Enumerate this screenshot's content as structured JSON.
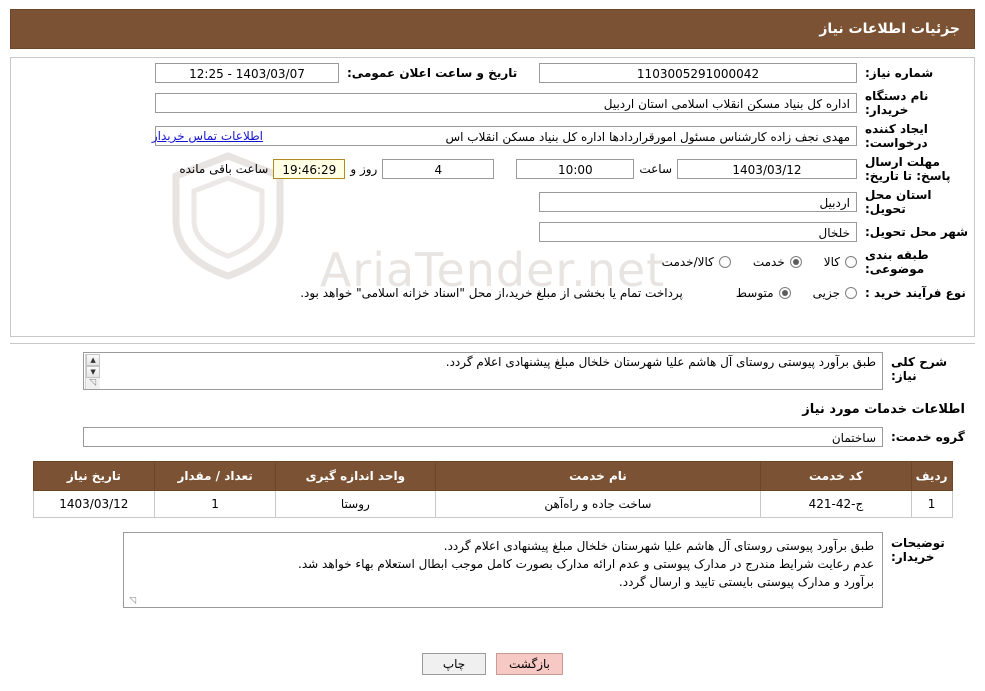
{
  "header": {
    "title": "جزئیات اطلاعات نیاز"
  },
  "form": {
    "need_number_label": "شماره نیاز:",
    "need_number_value": "1103005291000042",
    "announce_datetime_label": "تاریخ و ساعت اعلان عمومی:",
    "announce_datetime_value": "1403/03/07 - 12:25",
    "buyer_org_label": "نام دستگاه خریدار:",
    "buyer_org_value": "اداره کل بنیاد مسکن انقلاب اسلامی استان اردبیل",
    "requester_label": "ایجاد کننده درخواست:",
    "requester_value": "مهدی نجف زاده کارشناس مسئول امورقراردادها اداره کل بنیاد مسکن انقلاب اس",
    "requester_link": "اطلاعات تماس خریدار",
    "deadline_label": "مهلت ارسال پاسخ: تا تاریخ:",
    "deadline_date": "1403/03/12",
    "hour_label": "ساعت",
    "deadline_time": "10:00",
    "days_value": "4",
    "days_word": "روز و",
    "remaining_time": "19:46:29",
    "remaining_suffix": "ساعت باقی مانده",
    "delivery_province_label": "استان محل تحویل:",
    "delivery_province_value": "اردبیل",
    "delivery_city_label": "شهر محل تحویل:",
    "delivery_city_value": "خلخال",
    "category_label": "طبقه بندی موضوعی:",
    "category_options": [
      {
        "label": "کالا",
        "selected": false
      },
      {
        "label": "خدمت",
        "selected": true
      },
      {
        "label": "کالا/خدمت",
        "selected": false
      }
    ],
    "process_label": "نوع فرآیند خرید :",
    "process_options": [
      {
        "label": "جزیی",
        "selected": false
      },
      {
        "label": "متوسط",
        "selected": true
      }
    ],
    "process_note": "پرداخت تمام یا بخشی از مبلغ خرید،از محل \"اسناد خزانه اسلامی\" خواهد بود."
  },
  "description": {
    "label": "شرح کلی نیاز:",
    "value": "طبق برآورد پیوستی روستای آل هاشم علیا شهرستان خلخال مبلغ پیشنهادی اعلام گردد."
  },
  "services_section": {
    "title": "اطلاعات خدمات مورد نیاز",
    "group_label": "گروه خدمت:",
    "group_value": "ساختمان",
    "table": {
      "columns": [
        "ردیف",
        "کد خدمت",
        "نام خدمت",
        "واحد اندازه گیری",
        "تعداد / مقدار",
        "تاریخ نیاز"
      ],
      "rows": [
        {
          "row": "1",
          "code": "ج-42-421",
          "name": "ساخت جاده و راه‌آهن",
          "unit": "روستا",
          "qty": "1",
          "date": "1403/03/12"
        }
      ]
    }
  },
  "buyer_notes": {
    "label": "توضیحات خریدار:",
    "lines": [
      "طبق برآورد پیوستی روستای آل هاشم علیا شهرستان خلخال مبلغ پیشنهادی اعلام گردد.",
      "عدم رعایت شرایط مندرج در مدارک پیوستی و عدم ارائه مدارک بصورت کامل موجب ابطال استعلام بهاء خواهد شد.",
      "برآورد و مدارک پیوستی بایستی تایید و ارسال گردد."
    ]
  },
  "footer": {
    "print_label": "چاپ",
    "back_label": "بازگشت"
  },
  "watermark": {
    "text": "AriaTender.net"
  },
  "colors": {
    "header_brown": "#7b5334",
    "link_blue": "#1414cf",
    "back_button": "#f7c9c5"
  }
}
